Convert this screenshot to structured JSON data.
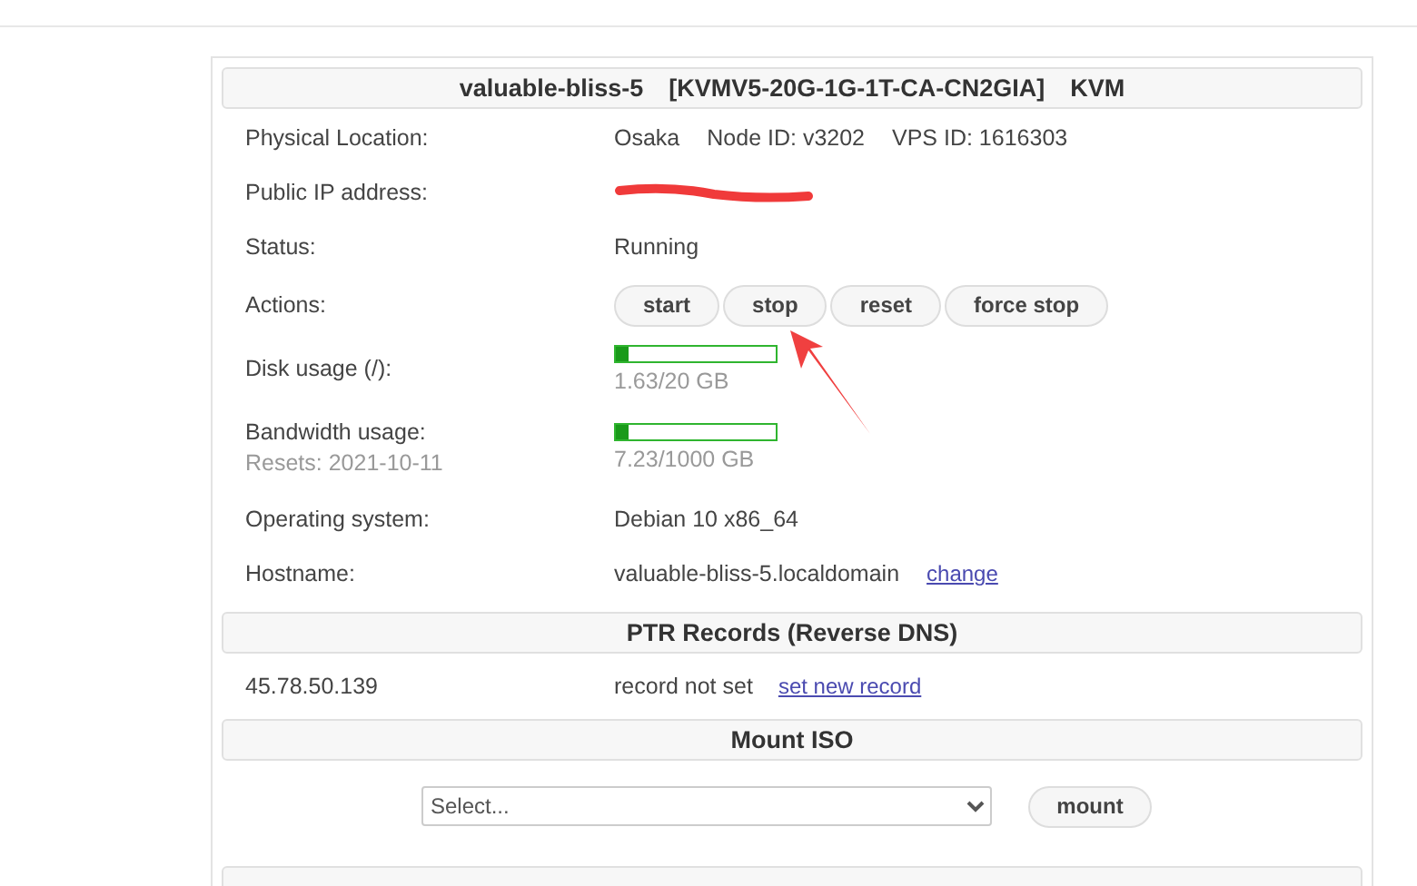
{
  "server": {
    "title_parts": [
      "valuable-bliss-5",
      "[KVMV5-20G-1G-1T-CA-CN2GIA]",
      "KVM"
    ],
    "rows": [
      {
        "kind": "text",
        "label": "Physical Location:",
        "values": [
          "Osaka",
          "Node ID: v3202",
          "VPS ID: 1616303"
        ]
      },
      {
        "kind": "redacted",
        "label": "Public IP address:"
      },
      {
        "kind": "text",
        "label": "Status:",
        "values": [
          "Running"
        ]
      },
      {
        "kind": "buttons",
        "label": "Actions:",
        "buttons": [
          "start",
          "stop",
          "reset",
          "force stop"
        ]
      },
      {
        "kind": "meter",
        "label": "Disk usage (/):",
        "level": 0.08,
        "reading": "1.63/20 GB"
      },
      {
        "kind": "meter",
        "label": "Bandwidth usage:",
        "sublabel": "Resets: 2021-10-11",
        "level": 0.08,
        "reading": "7.23/1000 GB"
      },
      {
        "kind": "text",
        "label": "Operating system:",
        "values": [
          "Debian 10 x86_64"
        ]
      },
      {
        "kind": "text",
        "label": "Hostname:",
        "values": [
          "valuable-bliss-5.localdomain"
        ],
        "link": "change"
      }
    ]
  },
  "ptr": {
    "title": "PTR Records (Reverse DNS)",
    "ip": "45.78.50.139",
    "status": "record not set",
    "link": "set new record"
  },
  "mount_iso": {
    "title": "Mount ISO",
    "select_value": "Select...",
    "button": "mount"
  }
}
